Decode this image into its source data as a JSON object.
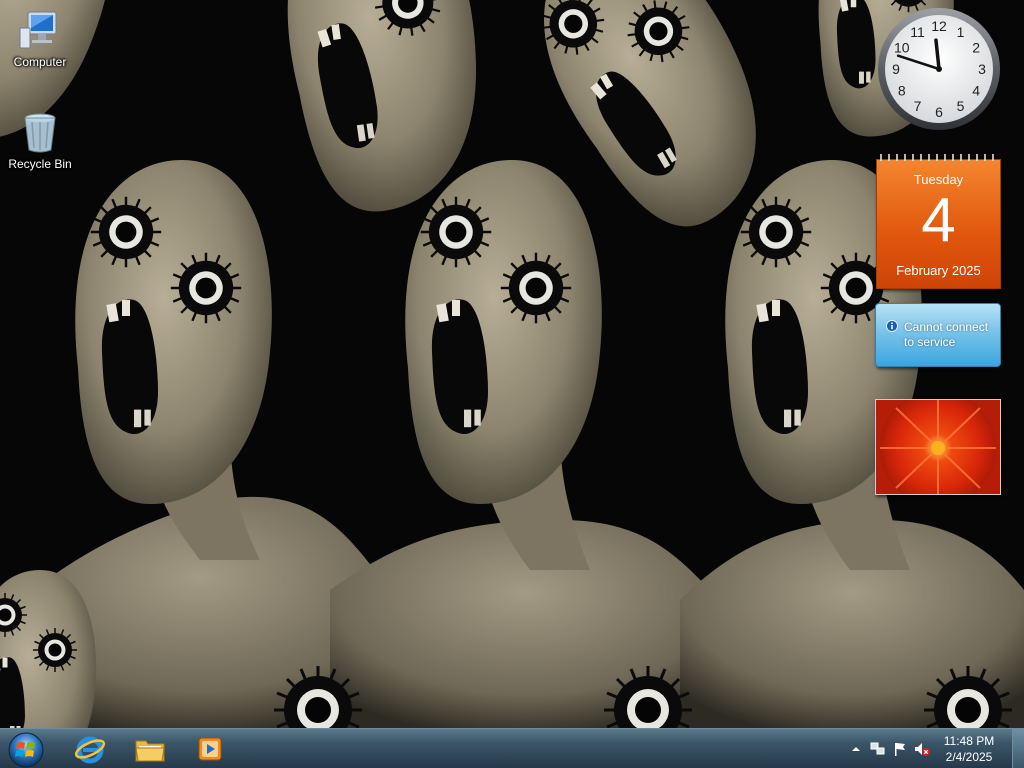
{
  "desktop": {
    "icons": [
      {
        "label": "Computer",
        "icon": "computer-icon"
      },
      {
        "label": "Recycle Bin",
        "icon": "recycle-bin-icon"
      }
    ],
    "wallpaper": "creepy-faces-wallpaper"
  },
  "gadgets": {
    "clock": {
      "hour": 11,
      "minute": 48,
      "numerals": [
        "12",
        "1",
        "2",
        "3",
        "4",
        "5",
        "6",
        "7",
        "8",
        "9",
        "10",
        "11"
      ]
    },
    "calendar": {
      "day_name": "Tuesday",
      "day_number": "4",
      "month_year": "February 2025"
    },
    "weather": {
      "message_line1": "Cannot connect",
      "message_line2": "to service",
      "icon": "info-icon"
    },
    "slideshow": {
      "image": "red-flower-photo"
    }
  },
  "taskbar": {
    "pinned": [
      {
        "name": "Internet Explorer",
        "icon": "internet-explorer-icon"
      },
      {
        "name": "Windows Explorer",
        "icon": "folder-icon"
      },
      {
        "name": "Windows Media Player",
        "icon": "media-player-icon"
      }
    ],
    "tray": {
      "time": "11:48 PM",
      "date": "2/4/2025",
      "icons": [
        "show-hidden-icons-arrow",
        "network-icon",
        "action-center-flag-icon",
        "volume-muted-icon"
      ]
    }
  },
  "colors": {
    "calendar_orange": "#e0560c",
    "weather_blue": "#3aa5de",
    "taskbar": "#3b5668"
  }
}
